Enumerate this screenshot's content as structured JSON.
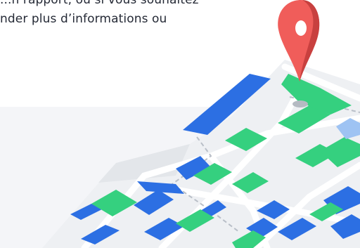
{
  "content": {
    "text_line_1": "...n rapport, ou si vous souhaitez",
    "text_line_2": "nder plus d’informations ou"
  },
  "illustration": {
    "icons": [
      "map-pin-icon",
      "city-map-illustration"
    ],
    "colors": {
      "pin": "#f05d5a",
      "pin_dark": "#c8403f",
      "block_blue": "#2c6fe3",
      "block_green": "#35d07f",
      "map_base": "#eef0f3",
      "road": "#dfe3e8",
      "route_dash": "#b9bfc8"
    }
  }
}
